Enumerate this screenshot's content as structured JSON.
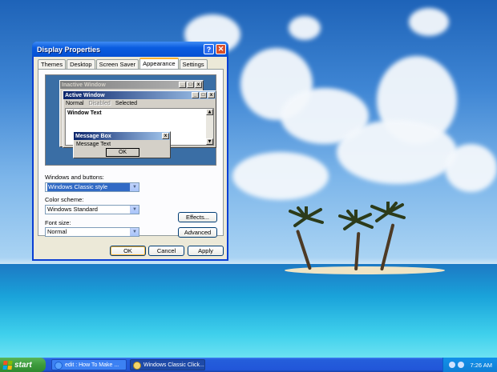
{
  "window": {
    "title": "Display Properties",
    "help_label": "?",
    "close_label": "✕",
    "tabs": [
      {
        "label": "Themes"
      },
      {
        "label": "Desktop"
      },
      {
        "label": "Screen Saver"
      },
      {
        "label": "Appearance",
        "active": true
      },
      {
        "label": "Settings"
      }
    ]
  },
  "preview": {
    "inactive_title": "Inactive Window",
    "active_title": "Active Window",
    "menu": {
      "normal": "Normal",
      "disabled": "Disabled",
      "selected": "Selected"
    },
    "window_text": "Window Text",
    "msgbox_title": "Message Box",
    "msgbox_text": "Message Text",
    "ok_label": "OK",
    "btn_min": "_",
    "btn_max": "□",
    "btn_close": "x"
  },
  "appearance": {
    "windows_buttons_label": "Windows and buttons:",
    "windows_buttons_value": "Windows Classic style",
    "color_scheme_label": "Color scheme:",
    "color_scheme_value": "Windows Standard",
    "font_size_label": "Font size:",
    "font_size_value": "Normal",
    "effects_label": "Effects...",
    "advanced_label": "Advanced"
  },
  "footer": {
    "ok_label": "OK",
    "cancel_label": "Cancel",
    "apply_label": "Apply"
  },
  "taskbar": {
    "start_label": "start",
    "items": [
      {
        "label": "edit : How To Make ...",
        "icon": "ie-icon"
      },
      {
        "label": "Windows Classic Click...",
        "icon": "paint-icon"
      }
    ],
    "clock": "7:26 AM"
  },
  "colors": {
    "title_blue": "#0550d3",
    "classic_active_title": "#0a246a",
    "selection": "#316ac5",
    "start_green": "#3c9a3c"
  }
}
